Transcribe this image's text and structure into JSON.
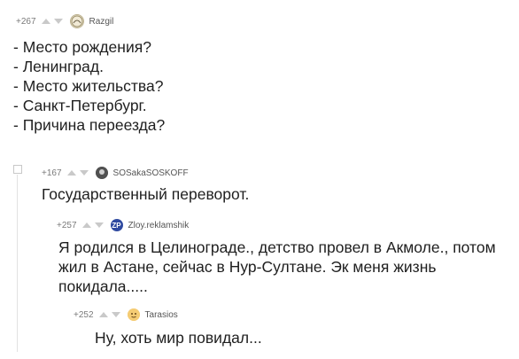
{
  "comments": [
    {
      "rating": "+267",
      "user": "Razgil",
      "text": "- Место рождения?\n- Ленинград.\n- Место жительства?\n- Санкт-Петербург.\n- Причина переезда?"
    },
    {
      "rating": "+167",
      "user": "SOSakaSOSKOFF",
      "text": "Государственный переворот."
    },
    {
      "rating": "+257",
      "user": "Zloy.reklamshik",
      "avatar_text": "ZP",
      "text": "Я родился в Целинограде., детство провел в Акмоле., потом жил в Астане, сейчас в Нур-Султане. Эк меня жизнь покидала....."
    },
    {
      "rating": "+252",
      "user": "Tarasios",
      "text": "Ну, хоть мир повидал..."
    }
  ],
  "colors": {
    "text": "#1f1f1f",
    "meta": "#7a7a7a",
    "arrow": "#c9c9c9"
  }
}
